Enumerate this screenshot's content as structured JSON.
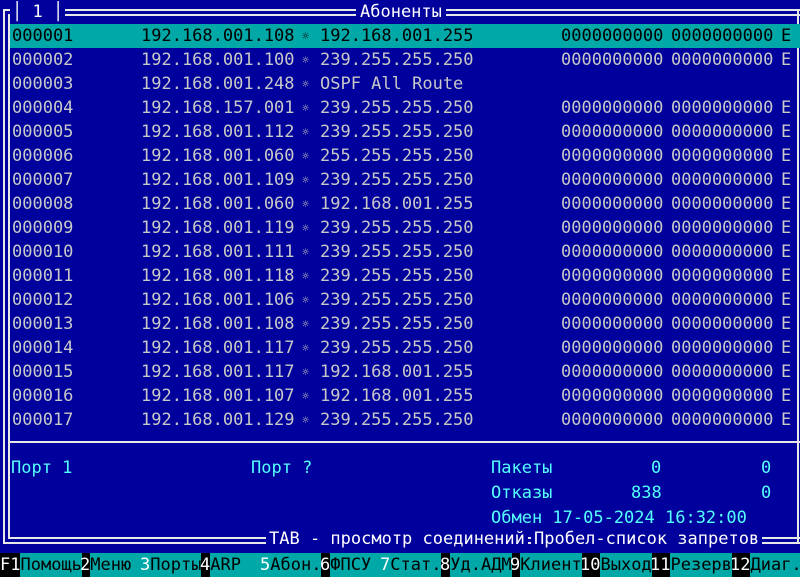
{
  "window": {
    "port_number": "1",
    "title": "Абоненты"
  },
  "table": {
    "rows": [
      {
        "id": "000001",
        "src": "192.168.001.108",
        "arrow": "☼",
        "dst": "192.168.001.255",
        "a": "0000000000",
        "b": "0000000000",
        "flag": "E",
        "selected": true
      },
      {
        "id": "000002",
        "src": "192.168.001.100",
        "arrow": "☼",
        "dst": "239.255.255.250",
        "a": "0000000000",
        "b": "0000000000",
        "flag": "E"
      },
      {
        "id": "000003",
        "src": "192.168.001.248",
        "arrow": "☼",
        "dst": "OSPF All Route",
        "a": "",
        "b": "",
        "flag": ""
      },
      {
        "id": "000004",
        "src": "192.168.157.001",
        "arrow": "☼",
        "dst": "239.255.255.250",
        "a": "0000000000",
        "b": "0000000000",
        "flag": "E"
      },
      {
        "id": "000005",
        "src": "192.168.001.112",
        "arrow": "☼",
        "dst": "239.255.255.250",
        "a": "0000000000",
        "b": "0000000000",
        "flag": "E"
      },
      {
        "id": "000006",
        "src": "192.168.001.060",
        "arrow": "☼",
        "dst": "255.255.255.250",
        "a": "0000000000",
        "b": "0000000000",
        "flag": "E"
      },
      {
        "id": "000007",
        "src": "192.168.001.109",
        "arrow": "☼",
        "dst": "239.255.255.250",
        "a": "0000000000",
        "b": "0000000000",
        "flag": "E"
      },
      {
        "id": "000008",
        "src": "192.168.001.060",
        "arrow": "☼",
        "dst": "192.168.001.255",
        "a": "0000000000",
        "b": "0000000000",
        "flag": "E"
      },
      {
        "id": "000009",
        "src": "192.168.001.119",
        "arrow": "☼",
        "dst": "239.255.255.250",
        "a": "0000000000",
        "b": "0000000000",
        "flag": "E"
      },
      {
        "id": "000010",
        "src": "192.168.001.111",
        "arrow": "☼",
        "dst": "239.255.255.250",
        "a": "0000000000",
        "b": "0000000000",
        "flag": "E"
      },
      {
        "id": "000011",
        "src": "192.168.001.118",
        "arrow": "☼",
        "dst": "239.255.255.250",
        "a": "0000000000",
        "b": "0000000000",
        "flag": "E"
      },
      {
        "id": "000012",
        "src": "192.168.001.106",
        "arrow": "☼",
        "dst": "239.255.255.250",
        "a": "0000000000",
        "b": "0000000000",
        "flag": "E"
      },
      {
        "id": "000013",
        "src": "192.168.001.108",
        "arrow": "☼",
        "dst": "239.255.255.250",
        "a": "0000000000",
        "b": "0000000000",
        "flag": "E"
      },
      {
        "id": "000014",
        "src": "192.168.001.117",
        "arrow": "☼",
        "dst": "239.255.255.250",
        "a": "0000000000",
        "b": "0000000000",
        "flag": "E"
      },
      {
        "id": "000015",
        "src": "192.168.001.117",
        "arrow": "☼",
        "dst": "192.168.001.255",
        "a": "0000000000",
        "b": "0000000000",
        "flag": "E"
      },
      {
        "id": "000016",
        "src": "192.168.001.107",
        "arrow": "☼",
        "dst": "192.168.001.255",
        "a": "0000000000",
        "b": "0000000000",
        "flag": "E"
      },
      {
        "id": "000017",
        "src": "192.168.001.129",
        "arrow": "☼",
        "dst": "239.255.255.250",
        "a": "0000000000",
        "b": "0000000000",
        "flag": "E"
      }
    ]
  },
  "info": {
    "port_left": "Порт 1",
    "port_mid": "Порт ?",
    "packets_label": "Пакеты",
    "packets_1": "0",
    "packets_2": "0",
    "refusals_label": "Отказы",
    "refusals_1": "838",
    "refusals_2": "0",
    "exchange": "Обмен 17-05-2024 16:32:00"
  },
  "hints": {
    "tab": "TAB - просмотр соединений",
    "space": "Пробел-список запретов"
  },
  "fkeys": [
    {
      "n": "F1",
      "l": "Помощь"
    },
    {
      "n": "2",
      "l": "Меню  "
    },
    {
      "n": "3",
      "l": "Порты"
    },
    {
      "n": "4",
      "l": "ARP   "
    },
    {
      "n": "5",
      "l": "Абон."
    },
    {
      "n": "6",
      "l": "ФПСУ  "
    },
    {
      "n": "7",
      "l": "Стат."
    },
    {
      "n": "8",
      "l": "Уд.АДМ"
    },
    {
      "n": "9",
      "l": "Клиент"
    },
    {
      "n": "10",
      "l": "Выход"
    },
    {
      "n": "11",
      "l": "Резерв"
    },
    {
      "n": "12",
      "l": "Диаг."
    }
  ],
  "colors": {
    "background": "#00009c",
    "selected_row": "#00a8a8",
    "info_text": "#55ffff",
    "row_text": "#c8c8c8"
  }
}
